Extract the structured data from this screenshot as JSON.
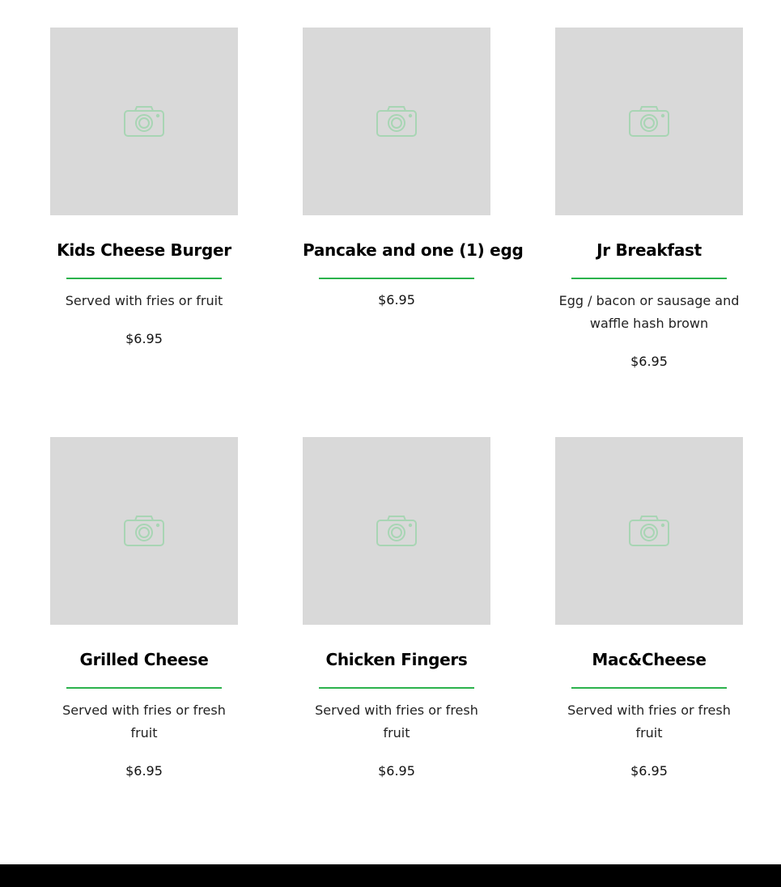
{
  "colors": {
    "accent": "#2bb24c",
    "placeholder_bg": "#d9d9d9",
    "camera_icon": "#a8d5b4",
    "footer": "#000000"
  },
  "menu": {
    "items": [
      {
        "title": "Kids Cheese Burger",
        "description": "Served with fries or fruit",
        "price": "$6.95",
        "icon": "camera-icon"
      },
      {
        "title": "Pancake and one (1) egg",
        "description": "",
        "price": "$6.95",
        "icon": "camera-icon"
      },
      {
        "title": "Jr Breakfast",
        "description": "Egg / bacon or sausage and waffle hash brown",
        "price": "$6.95",
        "icon": "camera-icon"
      },
      {
        "title": "Grilled Cheese",
        "description": "Served with fries or fresh fruit",
        "price": "$6.95",
        "icon": "camera-icon"
      },
      {
        "title": "Chicken Fingers",
        "description": "Served with fries or fresh fruit",
        "price": "$6.95",
        "icon": "camera-icon"
      },
      {
        "title": "Mac&Cheese",
        "description": "Served with fries or fresh fruit",
        "price": "$6.95",
        "icon": "camera-icon"
      }
    ]
  }
}
